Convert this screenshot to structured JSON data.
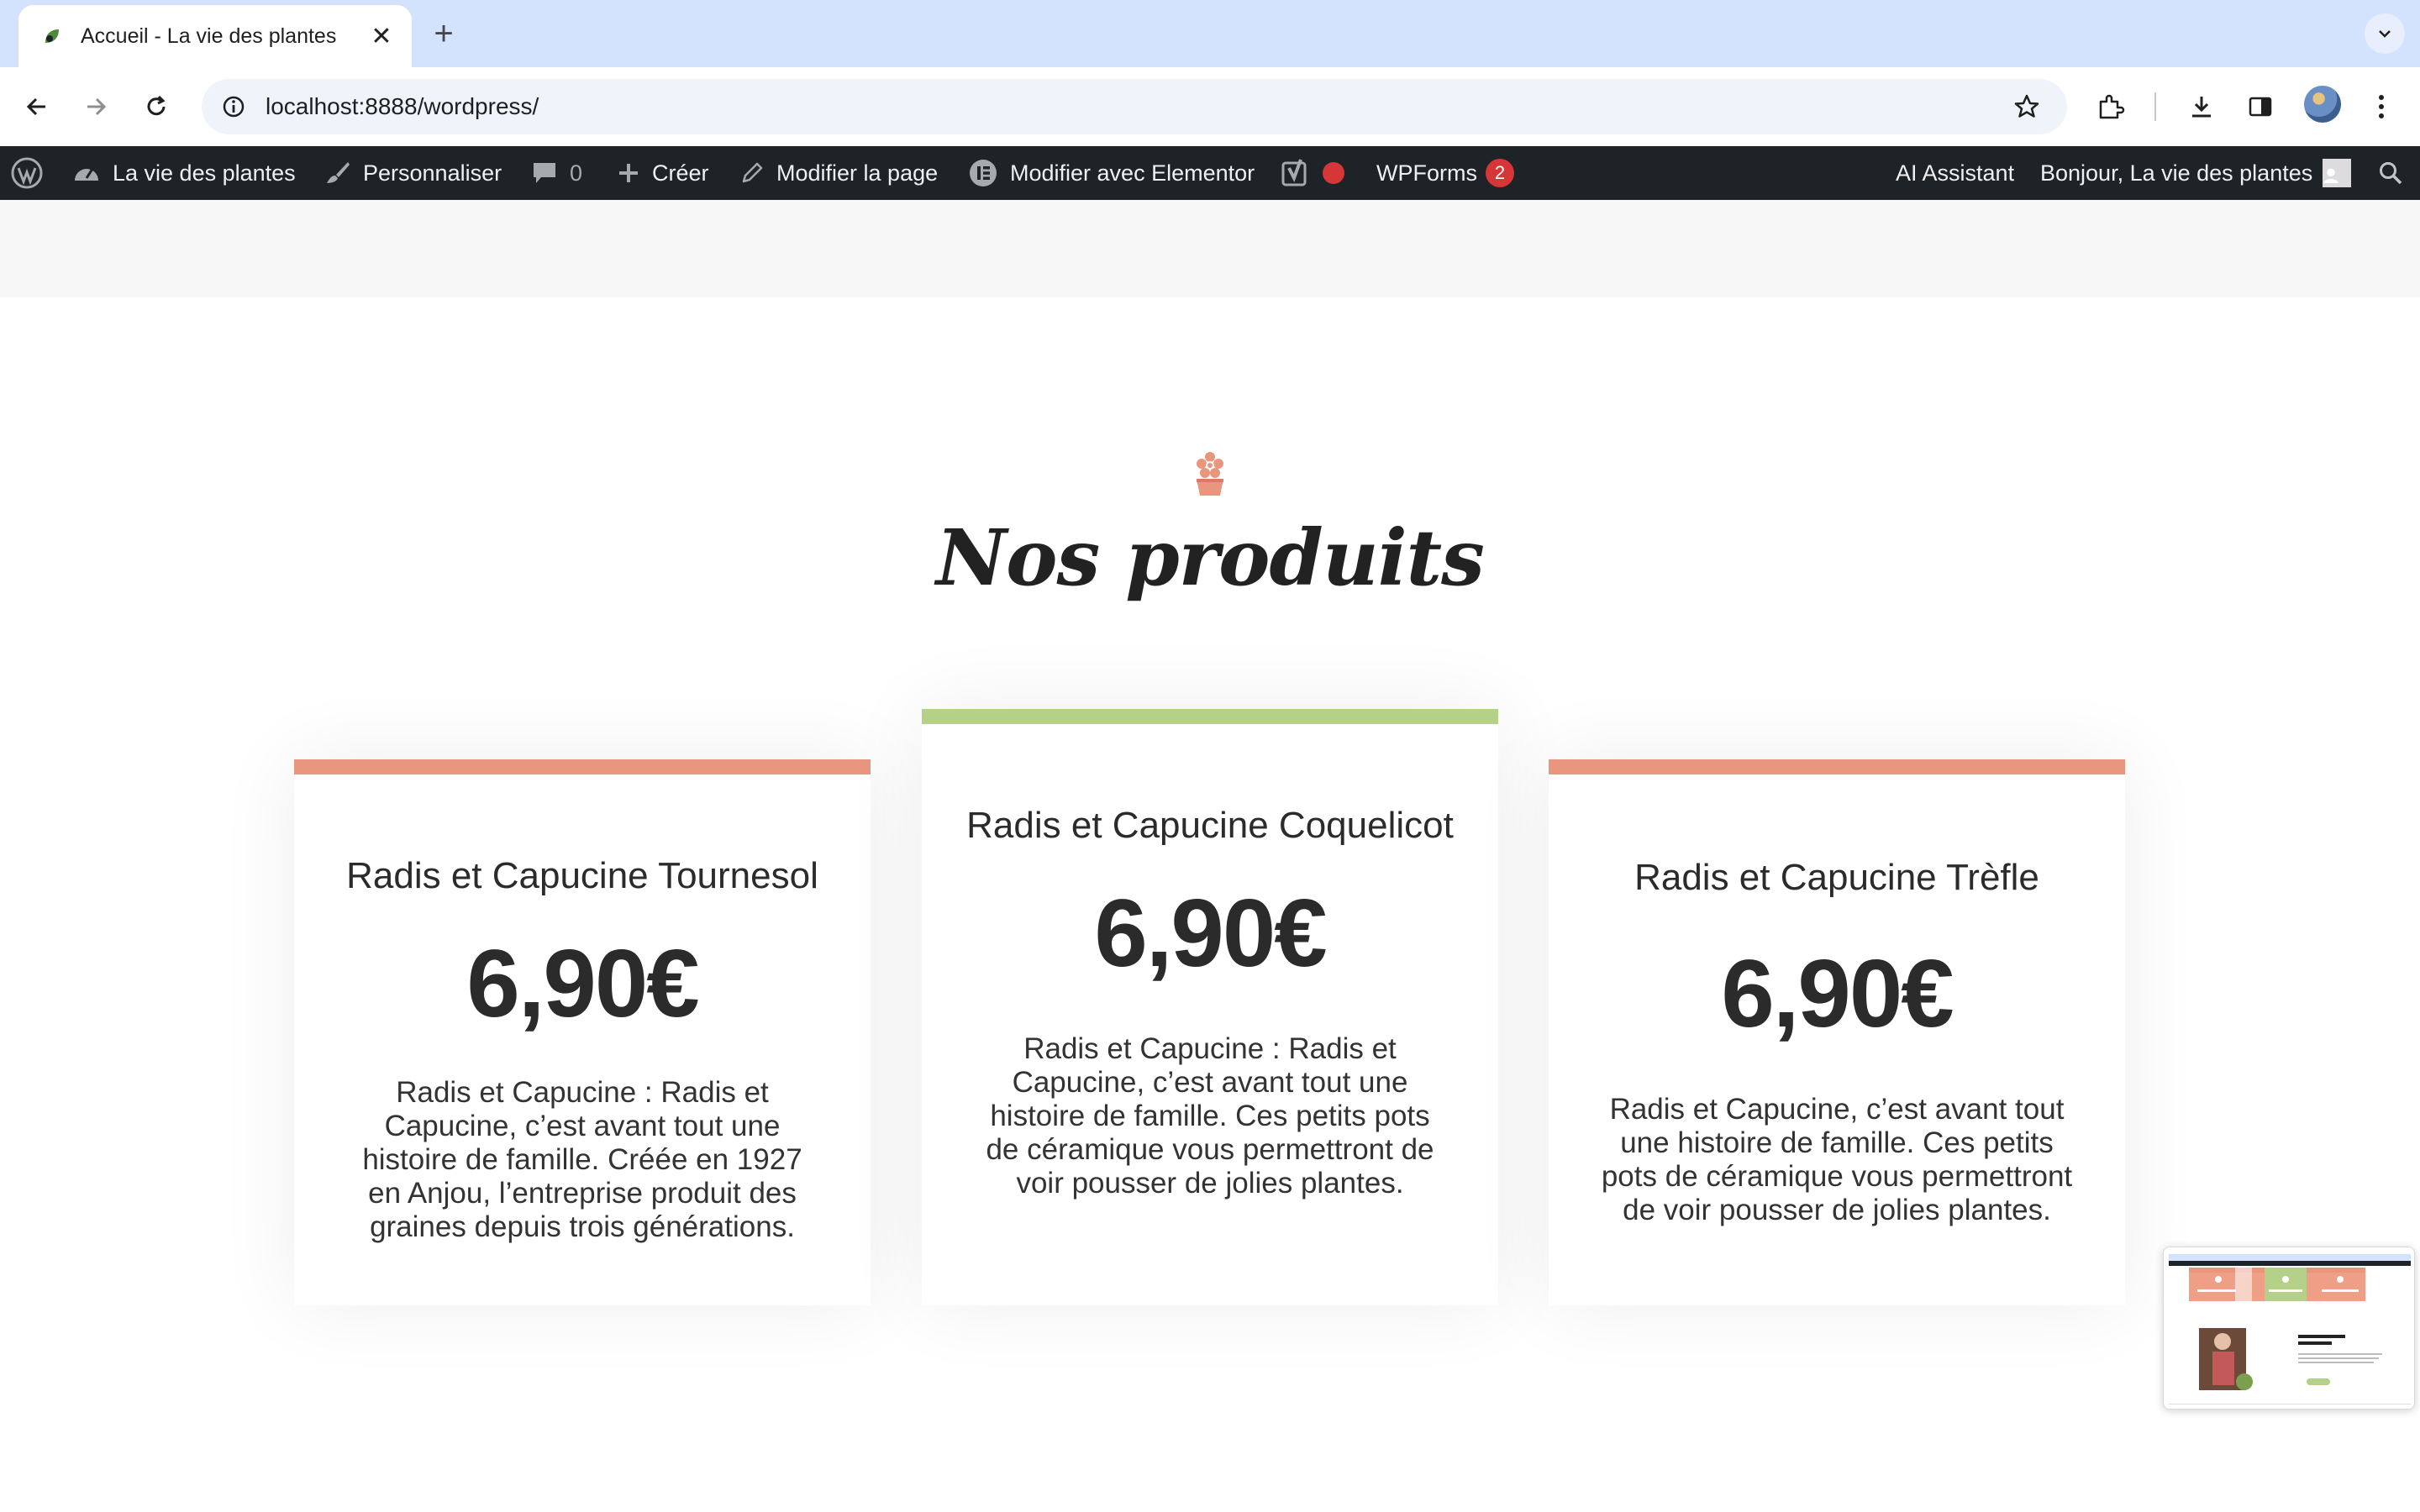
{
  "browser": {
    "tab_title": "Accueil - La vie des plantes",
    "url": "localhost:8888/wordpress/"
  },
  "adminbar": {
    "site_name": "La vie des plantes",
    "customize": "Personnaliser",
    "comments_count": "0",
    "create": "Créer",
    "edit_page": "Modifier la page",
    "edit_elementor": "Modifier avec Elementor",
    "wpforms": "WPForms",
    "wpforms_badge": "2",
    "ai_assistant": "AI Assistant",
    "greeting": "Bonjour, La vie des plantes"
  },
  "section": {
    "title": "Nos produits"
  },
  "colors": {
    "accent_salmon": "#e9967e",
    "accent_green": "#b5d189"
  },
  "products": [
    {
      "title": "Radis et Capucine Tournesol",
      "price": "6,90€",
      "description": "Radis et Capucine : Radis et Capucine, c’est avant tout une histoire de famille. Créée en 1927 en Anjou, l’entreprise produit des graines depuis trois générations."
    },
    {
      "title": "Radis et Capucine Coquelicot",
      "price": "6,90€",
      "description": "Radis et Capucine : Radis et Capucine, c’est avant tout une histoire de famille. Ces petits pots de céramique vous permettront de voir pousser de jolies plantes."
    },
    {
      "title": "Radis et Capucine Trèfle",
      "price": "6,90€",
      "description": "Radis et Capucine, c’est avant tout une histoire de famille. Ces petits pots de céramique vous permettront de voir pousser de jolies plantes."
    }
  ],
  "preview_thumbnail": {
    "heading": "La vie des plantes"
  }
}
